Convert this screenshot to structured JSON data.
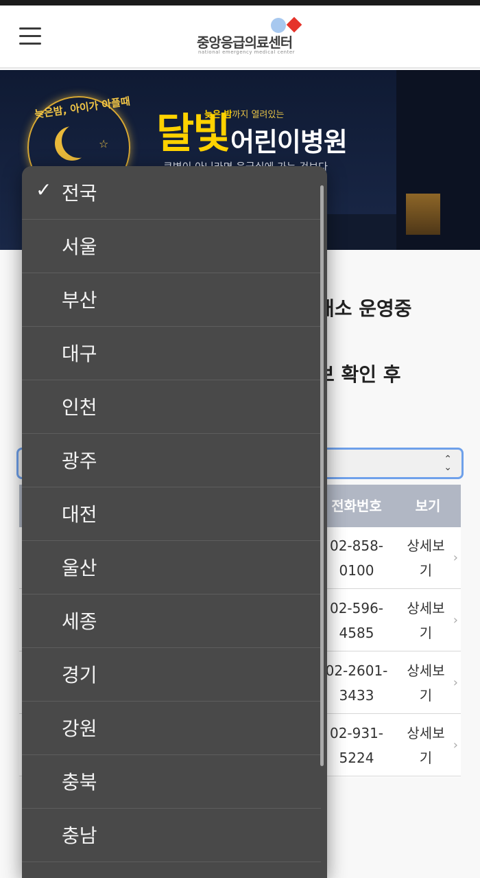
{
  "header": {
    "logo_kr": "중앙응급의료센터",
    "logo_en": "national emergency medical center"
  },
  "banner": {
    "badge_text": "늦은밤, 아이가 아플때",
    "tag_highlight": "늦은 밤",
    "tag_rest": "까지 열려있는",
    "title_a": "달빛",
    "title_b": "어린이병원",
    "subtitle": "큰병이 아니라면 응급실에 가는 것보다"
  },
  "notice": {
    "line1": "개소 운영중",
    "line2": "보 확인 후"
  },
  "table": {
    "headers": [
      "전화번호",
      "보기"
    ],
    "rows": [
      {
        "phone": "02-858-\n0100",
        "view": "상세보\n기"
      },
      {
        "phone": "02-596-\n4585",
        "view": "상세보\n기"
      },
      {
        "phone": "02-2601-\n3433",
        "view": "상세보\n기"
      },
      {
        "phone": "02-931-\n5224",
        "view": "상세보\n기"
      }
    ]
  },
  "dropdown": {
    "selected": "전국",
    "check_glyph": "✓",
    "options": [
      "전국",
      "서울",
      "부산",
      "대구",
      "인천",
      "광주",
      "대전",
      "울산",
      "세종",
      "경기",
      "강원",
      "충북",
      "충남"
    ]
  },
  "colors": {
    "dropdown_bg": "#494949",
    "select_focus": "#6ea0ea",
    "table_header": "#b1b7c4",
    "banner_yellow": "#ffd200"
  }
}
